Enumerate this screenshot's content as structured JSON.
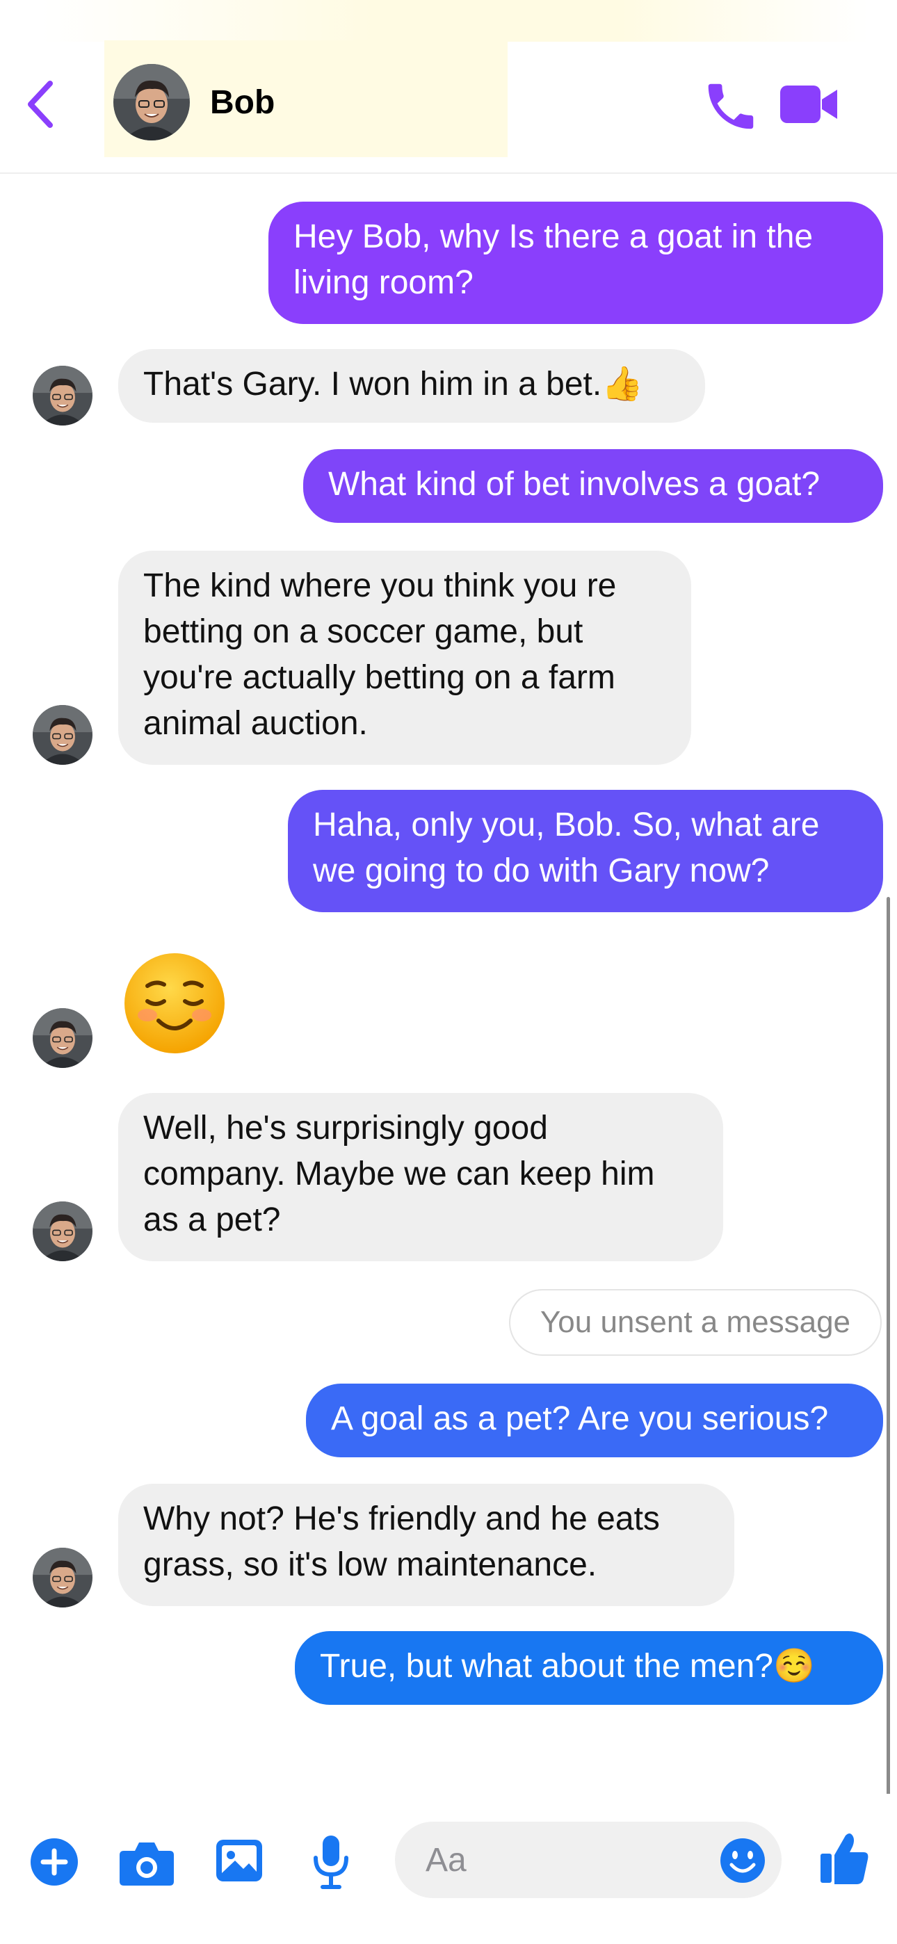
{
  "header": {
    "contact_name": "Bob",
    "back_icon": "chevron-left-icon",
    "call_icon": "phone-icon",
    "video_icon": "video-camera-icon"
  },
  "colors": {
    "accent": "#8a3ffc",
    "outgoing_gradient_top": "#8a3ffc",
    "outgoing_gradient_bottom": "#1877f2",
    "incoming_bg": "#efefef"
  },
  "messages": [
    {
      "from": "me",
      "text": "Hey Bob, why Is there a goat in the living room?"
    },
    {
      "from": "bob",
      "text": "That's Gary. I won him in a bet.👍"
    },
    {
      "from": "me",
      "text": "What kind of bet involves a goat?"
    },
    {
      "from": "bob",
      "text": "The kind where you think you re betting on a soccer game, but you're actually betting on a farm animal auction."
    },
    {
      "from": "me",
      "text": "Haha, only you, Bob. So, what are we going to do with Gary now?"
    },
    {
      "from": "bob",
      "text": "☺️"
    },
    {
      "from": "bob",
      "text": "Well, he's surprisingly good company. Maybe we can keep him as a pet?"
    },
    {
      "from": "me",
      "text": "You unsent a message"
    },
    {
      "from": "me",
      "text": "A goal as a pet? Are you serious?"
    },
    {
      "from": "bob",
      "text": "Why not? He's friendly and he eats grass, so it's low maintenance."
    },
    {
      "from": "me",
      "text": "True, but what about the men?☺️"
    }
  ],
  "composer": {
    "placeholder": "Aa",
    "icons": [
      "plus-icon",
      "camera-icon",
      "image-icon",
      "microphone-icon",
      "emoji-icon",
      "thumbs-up-icon"
    ]
  }
}
